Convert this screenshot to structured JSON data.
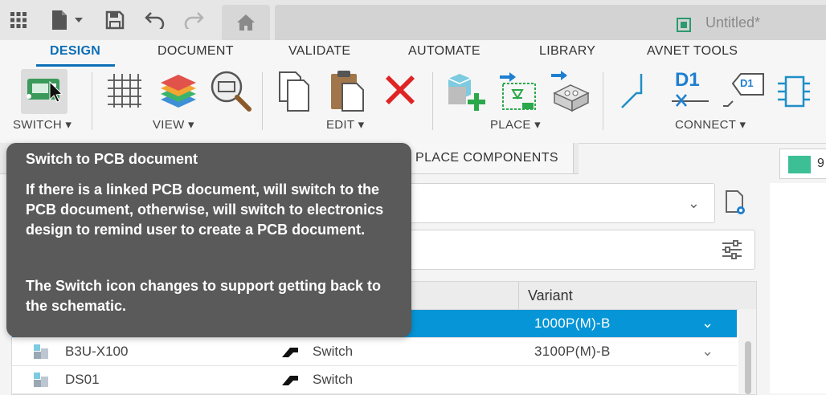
{
  "titlebar": {
    "document_title": "Untitled*"
  },
  "ribbon": {
    "tabs": [
      "DESIGN",
      "DOCUMENT",
      "VALIDATE",
      "AUTOMATE",
      "LIBRARY",
      "AVNET TOOLS"
    ],
    "active_tab": "DESIGN",
    "groups": {
      "switch": "SWITCH ▾",
      "view": "VIEW ▾",
      "edit": "EDIT ▾",
      "place": "PLACE ▾",
      "connect": "CONNECT ▾"
    },
    "connect_labels": {
      "d1_text": "D1",
      "d1_box_text": "D1"
    }
  },
  "panel": {
    "tab_place_components": "PLACE COMPONENTS",
    "swatch_value": "9",
    "swatch_color": "#3cbf95",
    "table": {
      "header_variant": "Variant",
      "rows": [
        {
          "name": "",
          "type": "",
          "variant": "1000P(M)-B",
          "selected": true
        },
        {
          "name": "B3U-X100",
          "type": "Switch",
          "variant": "3100P(M)-B",
          "selected": false
        },
        {
          "name": "DS01",
          "type": "Switch",
          "variant": "",
          "selected": false
        }
      ]
    }
  },
  "tooltip": {
    "title": "Switch to PCB document",
    "body": "If there is a linked PCB document, will switch to the PCB document, otherwise, will switch to electronics design to remind user to create a PCB document.",
    "body2": "The Switch icon changes to support getting back to the schematic."
  },
  "colors": {
    "accent": "#0c6fb7",
    "selection": "#0696d7",
    "delete_red": "#e02424"
  }
}
